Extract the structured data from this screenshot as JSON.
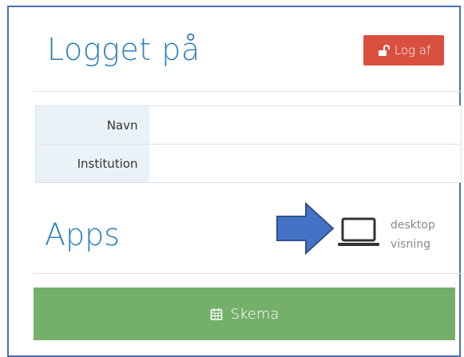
{
  "header": {
    "title": "Logget på",
    "logout_label": "Log af",
    "logout_icon": "unlock-icon",
    "logout_color": "#d9503f"
  },
  "user_info": {
    "rows": [
      {
        "label": "Navn",
        "value": ""
      },
      {
        "label": "Institution",
        "value": ""
      }
    ]
  },
  "apps": {
    "title": "Apps",
    "desktop_view": {
      "icon": "laptop-icon",
      "line1": "desktop",
      "line2": "visning"
    },
    "annotation_arrow": {
      "icon": "arrow-right-icon",
      "color": "#4472c4"
    },
    "skema_button": {
      "label": "Skema",
      "icon": "calendar-icon",
      "color": "#75b06a"
    }
  },
  "colors": {
    "heading": "#2c7fb8",
    "frame_border": "#4a6fb5"
  }
}
